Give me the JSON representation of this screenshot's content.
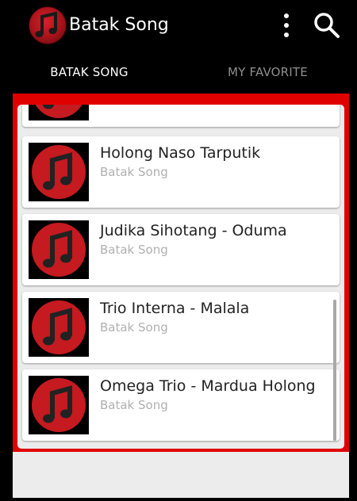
{
  "app": {
    "title": "Batak Song"
  },
  "tabs": [
    {
      "label": "BATAK SONG",
      "selected": true
    },
    {
      "label": "MY FAVORITE",
      "selected": false
    }
  ],
  "songs": [
    {
      "title": "",
      "subtitle": "",
      "partial": true
    },
    {
      "title": "Holong Naso Tarputik",
      "subtitle": "Batak Song"
    },
    {
      "title": "Judika Sihotang - Oduma",
      "subtitle": "Batak Song"
    },
    {
      "title": "Trio Interna - Malala",
      "subtitle": "Batak Song"
    },
    {
      "title": "Omega Trio - Mardua Holong",
      "subtitle": "Batak Song"
    }
  ],
  "colors": {
    "accent": "#e00000",
    "toolbar": "#000000",
    "card": "#ffffff",
    "subtitle": "#b0b0b0"
  },
  "icons": {
    "app": "music-note-icon",
    "overflow": "more-vert-icon",
    "search": "search-icon"
  }
}
